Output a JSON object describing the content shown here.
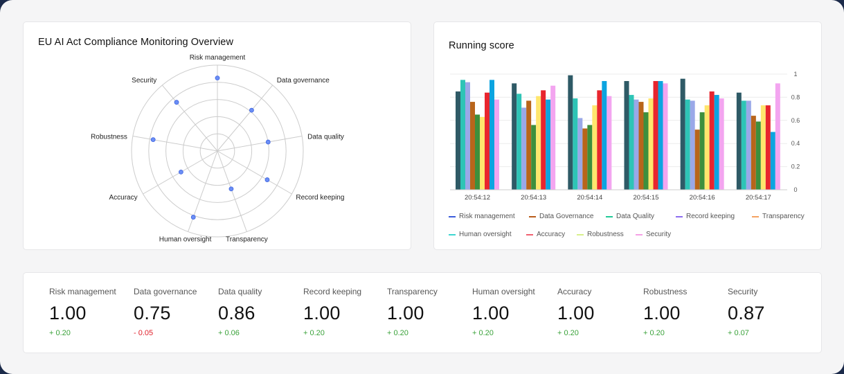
{
  "radar_card": {
    "title": "EU AI Act Compliance Monitoring Overview",
    "axes": [
      "Risk management",
      "Data governance",
      "Data quality",
      "Record keeping",
      "Transparency",
      "Human oversight",
      "Accuracy",
      "Robustness",
      "Security"
    ],
    "values": [
      0.85,
      0.62,
      0.6,
      0.67,
      0.47,
      0.82,
      0.49,
      0.76,
      0.74
    ],
    "point_color": "#6b8ef5",
    "ring_color": "#cccccc"
  },
  "bar_card": {
    "title": "Running score",
    "legend": [
      {
        "label": "Risk management",
        "color": "#3b5bdb"
      },
      {
        "label": "Data Governance",
        "color": "#b85c1a"
      },
      {
        "label": "Data Quality",
        "color": "#20c997"
      },
      {
        "label": "Record keeping",
        "color": "#8c6cf0"
      },
      {
        "label": "Transparency",
        "color": "#f4a261"
      },
      {
        "label": "Human oversight",
        "color": "#3dd6d0"
      },
      {
        "label": "Accuracy",
        "color": "#f06070"
      },
      {
        "label": "Robustness",
        "color": "#d8f08a"
      },
      {
        "label": "Security",
        "color": "#f5a0e6"
      }
    ]
  },
  "chart_data": {
    "type": "bar",
    "categories": [
      "20:54:12",
      "20:54:13",
      "20:54:14",
      "20:54:15",
      "20:54:16",
      "20:54:17"
    ],
    "ylim": [
      0,
      1
    ],
    "yticks": [
      "0",
      "0.2",
      "0.4",
      "0.6",
      "0.8",
      "1"
    ],
    "bar_colors": [
      "#2e5a66",
      "#2ec4b6",
      "#9aa8e8",
      "#b8651b",
      "#3d8f3d",
      "#ffe66d",
      "#e8252e",
      "#0ca4e0",
      "#f3a5f0"
    ],
    "series_values": [
      [
        0.85,
        0.95,
        0.93,
        0.76,
        0.65,
        0.63,
        0.84,
        0.95,
        0.78
      ],
      [
        0.92,
        0.83,
        0.71,
        0.77,
        0.56,
        0.81,
        0.86,
        0.78,
        0.9
      ],
      [
        0.99,
        0.79,
        0.62,
        0.53,
        0.56,
        0.73,
        0.86,
        0.94,
        0.81
      ],
      [
        0.94,
        0.82,
        0.78,
        0.76,
        0.67,
        0.79,
        0.94,
        0.94,
        0.92
      ],
      [
        0.96,
        0.78,
        0.77,
        0.52,
        0.67,
        0.73,
        0.85,
        0.82,
        0.79
      ],
      [
        0.84,
        0.77,
        0.77,
        0.64,
        0.59,
        0.73,
        0.73,
        0.5,
        0.92
      ]
    ]
  },
  "metrics": [
    {
      "label": "Risk management",
      "value": "1.00",
      "delta": "+ 0.20",
      "positive": true
    },
    {
      "label": "Data governance",
      "value": "0.75",
      "delta": "- 0.05",
      "positive": false
    },
    {
      "label": "Data quality",
      "value": "0.86",
      "delta": "+ 0.06",
      "positive": true
    },
    {
      "label": "Record keeping",
      "value": "1.00",
      "delta": "+ 0.20",
      "positive": true
    },
    {
      "label": "Transparency",
      "value": "1.00",
      "delta": "+ 0.20",
      "positive": true
    },
    {
      "label": "Human oversight",
      "value": "1.00",
      "delta": "+ 0.20",
      "positive": true
    },
    {
      "label": "Accuracy",
      "value": "1.00",
      "delta": "+ 0.20",
      "positive": true
    },
    {
      "label": "Robustness",
      "value": "1.00",
      "delta": "+ 0.20",
      "positive": true
    },
    {
      "label": "Security",
      "value": "0.87",
      "delta": "+ 0.07",
      "positive": true
    }
  ]
}
